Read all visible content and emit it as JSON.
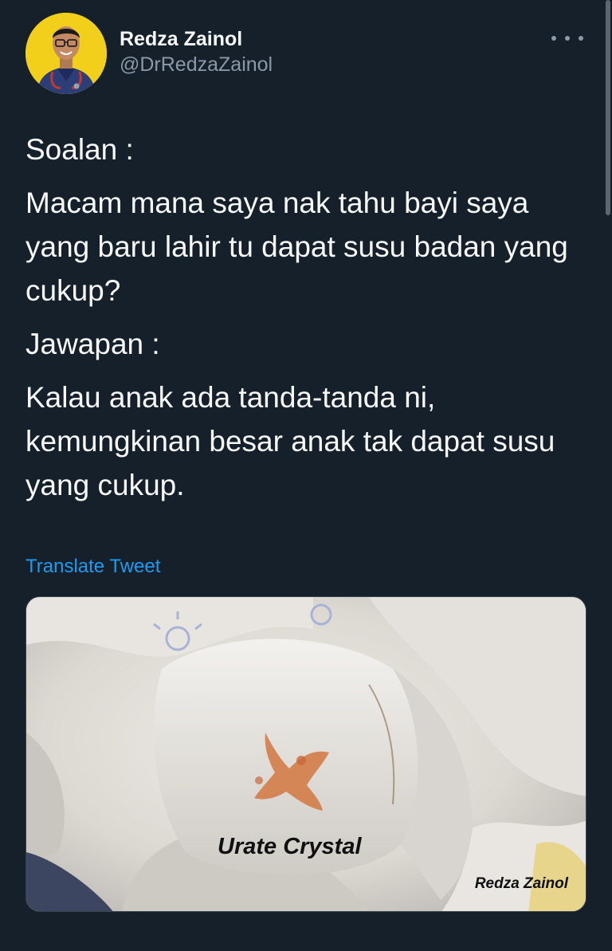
{
  "author": {
    "display_name": "Redza Zainol",
    "handle": "@DrRedzaZainol",
    "avatar_color": "#f2cf1a"
  },
  "icons": {
    "more": "more-horizontal-icon"
  },
  "tweet": {
    "paragraphs": [
      "Soalan :",
      "Macam mana saya nak tahu bayi saya yang baru lahir tu dapat susu badan yang cukup?",
      "Jawapan :",
      "Kalau anak ada tanda-tanda ni, kemungkinan besar anak tak dapat susu yang cukup."
    ],
    "translate_label": "Translate Tweet"
  },
  "media": {
    "caption": "Urate Crystal",
    "credit": "Redza Zainol"
  },
  "colors": {
    "background": "#15202b",
    "text": "#f7f9f9",
    "secondary_text": "#8b98a5",
    "link": "#1d9bf0"
  }
}
